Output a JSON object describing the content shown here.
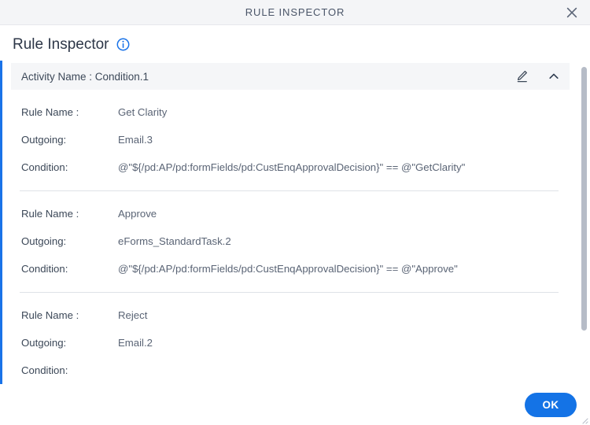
{
  "window": {
    "title": "RULE INSPECTOR",
    "close_icon": "close-icon"
  },
  "header": {
    "page_title": "Rule Inspector",
    "info_icon": "info-icon"
  },
  "accordion": {
    "activity_title": "Activity Name : Condition.1",
    "edit_icon": "pencil-edit-icon",
    "collapse_icon": "chevron-up-icon"
  },
  "labels": {
    "rule_name": "Rule Name :",
    "outgoing": "Outgoing:",
    "condition": "Condition:"
  },
  "rules": [
    {
      "rule_name": "Get Clarity",
      "outgoing": "Email.3",
      "condition": "@\"${/pd:AP/pd:formFields/pd:CustEnqApprovalDecision}\" == @\"GetClarity\""
    },
    {
      "rule_name": "Approve",
      "outgoing": "eForms_StandardTask.2",
      "condition": "@\"${/pd:AP/pd:formFields/pd:CustEnqApprovalDecision}\" == @\"Approve\""
    },
    {
      "rule_name": "Reject",
      "outgoing": "Email.2",
      "condition": ""
    }
  ],
  "footer": {
    "ok_label": "OK"
  },
  "colors": {
    "accent": "#1473e6",
    "titlebar_bg": "#f4f5f7",
    "accordion_bg": "#f5f6f8",
    "left_rail": "#1a73e8",
    "scrollbar_thumb": "#b6bcc7"
  }
}
